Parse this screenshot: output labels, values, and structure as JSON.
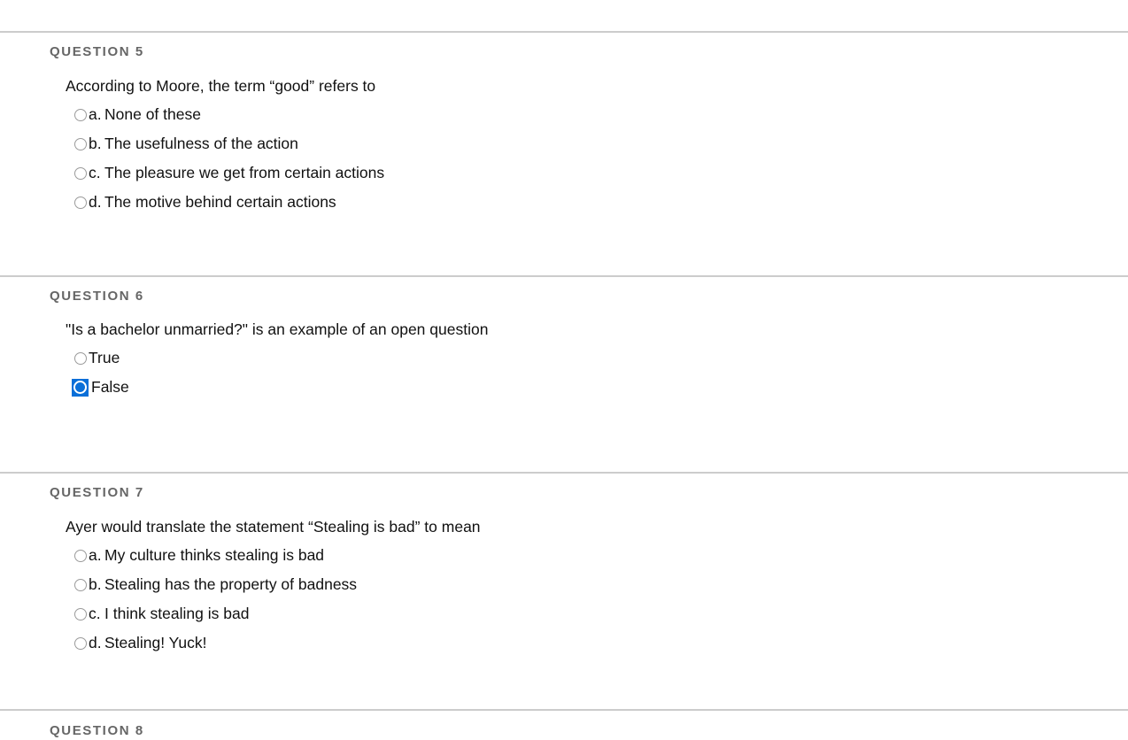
{
  "page": {
    "background": "#ffffff",
    "divider_color": "#cccccc",
    "header_color": "#666666",
    "text_color": "#111111",
    "accent_color": "#0a6fd8"
  },
  "questions": [
    {
      "header": "QUESTION 5",
      "text": "According to Moore, the term “good” refers to",
      "type": "multiple-choice",
      "options": [
        {
          "letter": "a.",
          "label": "None of these",
          "selected": false
        },
        {
          "letter": "b.",
          "label": "The usefulness of the action",
          "selected": false
        },
        {
          "letter": "c.",
          "label": "The pleasure we get from certain actions",
          "selected": false
        },
        {
          "letter": "d.",
          "label": "The motive behind certain actions",
          "selected": false
        }
      ]
    },
    {
      "header": "QUESTION 6",
      "text": "\"Is a bachelor unmarried?\" is an example of an open question",
      "type": "true-false",
      "options": [
        {
          "letter": "",
          "label": "True",
          "selected": false
        },
        {
          "letter": "",
          "label": "False",
          "selected": true
        }
      ]
    },
    {
      "header": "QUESTION 7",
      "text": "Ayer would translate the statement “Stealing is bad” to mean",
      "type": "multiple-choice",
      "options": [
        {
          "letter": "a.",
          "label": "My culture thinks stealing is bad",
          "selected": false
        },
        {
          "letter": "b.",
          "label": "Stealing has the property of badness",
          "selected": false
        },
        {
          "letter": "c.",
          "label": "I think stealing is bad",
          "selected": false
        },
        {
          "letter": "d.",
          "label": "Stealing! Yuck!",
          "selected": false
        }
      ]
    },
    {
      "header": "QUESTION 8",
      "text": "",
      "type": "cut-off",
      "options": []
    }
  ]
}
